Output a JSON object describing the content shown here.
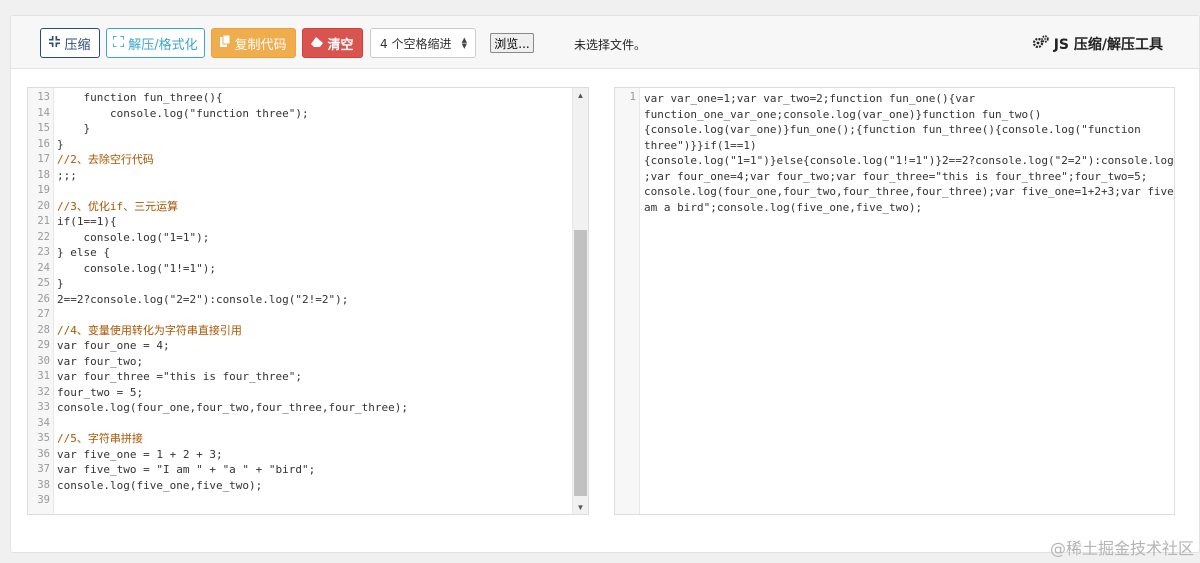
{
  "toolbar": {
    "compress_label": "压缩",
    "format_label": "解压/格式化",
    "copy_label": "复制代码",
    "clear_label": "清空",
    "indent_select_value": "4 个空格缩进",
    "browse_label": "浏览...",
    "no_file_text": "未选择文件。",
    "tool_title": "JS 压缩/解压工具"
  },
  "editor_left": {
    "lines": [
      {
        "n": "13",
        "text": "    function fun_three(){",
        "kind": "code"
      },
      {
        "n": "14",
        "text": "        console.log(\"function three\");",
        "kind": "code"
      },
      {
        "n": "15",
        "text": "    }",
        "kind": "code"
      },
      {
        "n": "16",
        "text": "}",
        "kind": "code"
      },
      {
        "n": "17",
        "text": "//2、去除空行代码",
        "kind": "comment"
      },
      {
        "n": "18",
        "text": ";;;",
        "kind": "code"
      },
      {
        "n": "19",
        "text": "",
        "kind": "code"
      },
      {
        "n": "20",
        "text": "//3、优化if、三元运算",
        "kind": "comment"
      },
      {
        "n": "21",
        "text": "if(1==1){",
        "kind": "code"
      },
      {
        "n": "22",
        "text": "    console.log(\"1=1\");",
        "kind": "code"
      },
      {
        "n": "23",
        "text": "} else {",
        "kind": "code"
      },
      {
        "n": "24",
        "text": "    console.log(\"1!=1\");",
        "kind": "code"
      },
      {
        "n": "25",
        "text": "}",
        "kind": "code"
      },
      {
        "n": "26",
        "text": "2==2?console.log(\"2=2\"):console.log(\"2!=2\");",
        "kind": "code"
      },
      {
        "n": "27",
        "text": "",
        "kind": "code"
      },
      {
        "n": "28",
        "text": "//4、变量使用转化为字符串直接引用",
        "kind": "comment"
      },
      {
        "n": "29",
        "text": "var four_one = 4;",
        "kind": "code"
      },
      {
        "n": "30",
        "text": "var four_two;",
        "kind": "code"
      },
      {
        "n": "31",
        "text": "var four_three =\"this is four_three\";",
        "kind": "code"
      },
      {
        "n": "32",
        "text": "four_two = 5;",
        "kind": "code"
      },
      {
        "n": "33",
        "text": "console.log(four_one,four_two,four_three,four_three);",
        "kind": "code"
      },
      {
        "n": "34",
        "text": "",
        "kind": "code"
      },
      {
        "n": "35",
        "text": "//5、字符串拼接",
        "kind": "comment"
      },
      {
        "n": "36",
        "text": "var five_one = 1 + 2 + 3;",
        "kind": "code"
      },
      {
        "n": "37",
        "text": "var five_two = \"I am \" + \"a \" + \"bird\";",
        "kind": "code"
      },
      {
        "n": "38",
        "text": "console.log(five_one,five_two);",
        "kind": "code"
      },
      {
        "n": "39",
        "text": "",
        "kind": "code"
      }
    ]
  },
  "editor_right": {
    "line_number": "1",
    "wrapped_lines": [
      "var var_one=1;var var_two=2;function fun_one(){var",
      "function_one_var_one;console.log(var_one)}function fun_two()",
      "{console.log(var_one)}fun_one();{function fun_three(){console.log(\"function",
      "three\")}}if(1==1)",
      "{console.log(\"1=1\")}else{console.log(\"1!=1\")}2==2?console.log(\"2=2\"):console.log(\"2!=2\")",
      ";var four_one=4;var four_two;var four_three=\"this is four_three\";four_two=5;",
      "console.log(four_one,four_two,four_three,four_three);var five_one=1+2+3;var five_two=\"I",
      "am a bird\";console.log(five_one,five_two);"
    ]
  },
  "watermark": "@稀土掘金技术社区",
  "icons": {
    "compress": "compress-icon",
    "format": "expand-icon",
    "copy": "copy-icon",
    "clear": "eraser-icon",
    "title": "gears-icon"
  },
  "colors": {
    "compress_border": "#2c4a7a",
    "format_border": "#3aa6c9",
    "copy_bg": "#f0ad4e",
    "clear_bg": "#d9534f"
  }
}
